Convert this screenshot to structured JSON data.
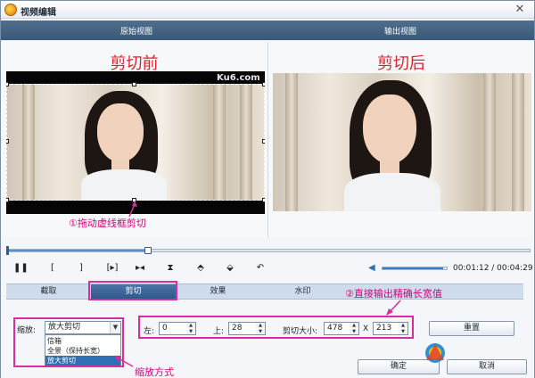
{
  "window": {
    "title": "视频编辑",
    "close_glyph": "✕"
  },
  "views": {
    "original": "原始视图",
    "output": "输出视图"
  },
  "preview": {
    "before_caption": "剪切前",
    "after_caption": "剪切后",
    "watermark": "Ku6.com"
  },
  "annotations": {
    "drag_hint": "①拖动虚线框剪切",
    "size_hint": "②直接输出精确长宽值",
    "zoom_hint": "缩放方式"
  },
  "timeline": {
    "position_fraction": 0.27
  },
  "playback": {
    "buttons": [
      {
        "name": "pause-button",
        "glyph": "❚❚"
      },
      {
        "name": "mark-in-button",
        "glyph": "["
      },
      {
        "name": "mark-out-button",
        "glyph": "]"
      },
      {
        "name": "play-selection-button",
        "glyph": "[▸]"
      },
      {
        "name": "prev-segment-button",
        "glyph": "▸◂"
      },
      {
        "name": "flip-vertical-button",
        "glyph": "⧗"
      },
      {
        "name": "rotate-left-button",
        "glyph": "⬘"
      },
      {
        "name": "rotate-right-button",
        "glyph": "⬙"
      },
      {
        "name": "reset-rotation-button",
        "glyph": "↶"
      }
    ],
    "volume_fraction": 0.95,
    "time_display": "00:01:12 / 00:04:29"
  },
  "tabs": [
    {
      "label": "截取",
      "active": false
    },
    {
      "label": "剪切",
      "active": true
    },
    {
      "label": "效果",
      "active": false
    },
    {
      "label": "水印",
      "active": false
    }
  ],
  "crop": {
    "zoom_label": "缩放:",
    "zoom_value": "放大剪切",
    "zoom_options": [
      "信箱",
      "全景（保持长宽）",
      "放大剪切"
    ],
    "left_label": "左:",
    "left_value": "0",
    "top_label": "上:",
    "top_value": "28",
    "size_label": "剪切大小:",
    "width_value": "478",
    "times": "X",
    "height_value": "213",
    "reset_label": "重置"
  },
  "footer": {
    "ok_label": "确定",
    "cancel_label": "取消"
  },
  "colors": {
    "annotation": "#d62ea0",
    "caption_red": "#e0202a",
    "accent_blue": "#2f6fb3"
  }
}
